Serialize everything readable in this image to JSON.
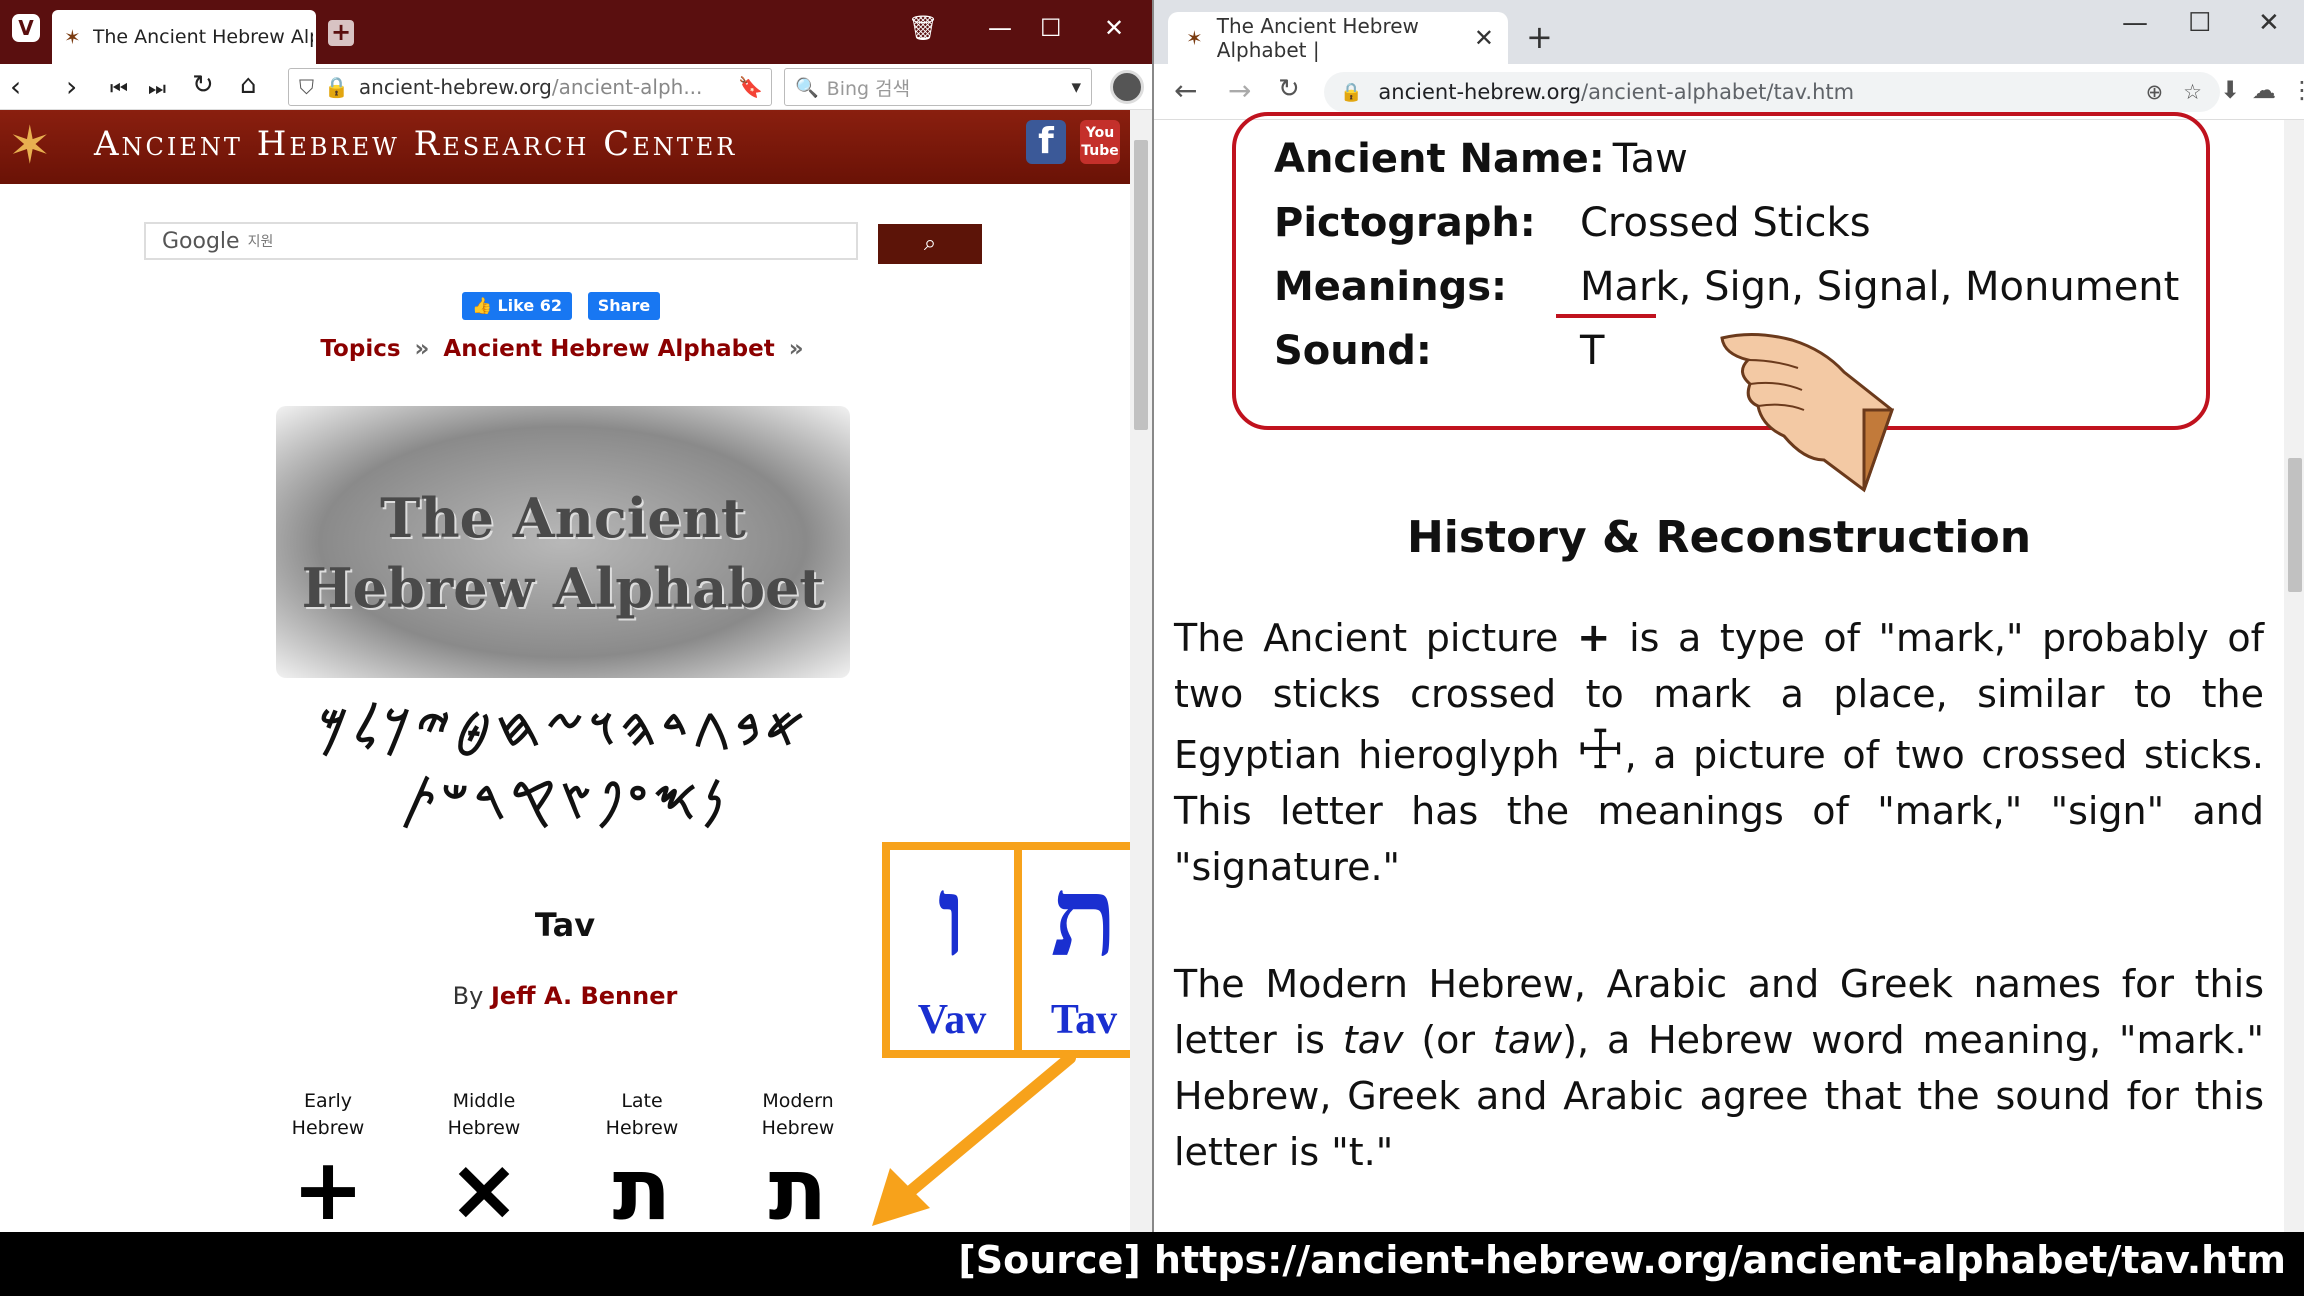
{
  "left": {
    "tab_title": "The Ancient Hebrew Alphab",
    "url_main": "ancient-hebrew.org",
    "url_path": "/ancient-alph...",
    "search_placeholder": "Bing 검색",
    "site_title": "Ancient Hebrew Research Center",
    "fb_icon": "f",
    "yt_icon": "You Tube",
    "google_label": "Google",
    "google_hint": "지원",
    "like_label": "Like 62",
    "share_label": "Share",
    "crumb_topics": "Topics",
    "crumb_alphabet": "Ancient Hebrew Alphabet",
    "crumb_sep": "»",
    "hero_line1": "The Ancient",
    "hero_line2": "Hebrew Alphabet",
    "glyphs_row1": "𐤀𐤁𐤂𐤃𐤄𐤅𐤆𐤇𐤈𐤉𐤊𐤋𐤌",
    "glyphs_row2": "𐤍𐤎𐤏𐤐𐤑𐤒𐤓𐤔𐤕",
    "letter_title": "Tav",
    "by_prefix": "By",
    "author": "Jeff A. Benner",
    "evolution": [
      {
        "line1": "Early",
        "line2": "Hebrew",
        "glyph": "+"
      },
      {
        "line1": "Middle",
        "line2": "Hebrew",
        "glyph": "×"
      },
      {
        "line1": "Late",
        "line2": "Hebrew",
        "glyph": "ת"
      },
      {
        "line1": "Modern",
        "line2": "Hebrew",
        "glyph": "ת"
      }
    ],
    "compare": [
      {
        "letter": "ו",
        "label": "Vav"
      },
      {
        "letter": "ת",
        "label": "Tav"
      }
    ]
  },
  "right": {
    "tab_title": "The Ancient Hebrew Alphabet |",
    "url_main": "ancient-hebrew.org",
    "url_path": "/ancient-alphabet/tav.htm",
    "info": [
      {
        "key": "Ancient Name:",
        "value": "Taw"
      },
      {
        "key": "Pictograph:",
        "value": "Crossed Sticks"
      },
      {
        "key": "Meanings:",
        "value": "Mark, Sign, Signal, Monument"
      },
      {
        "key": "Sound:",
        "value": "T"
      }
    ],
    "history_heading": "History & Reconstruction",
    "p1_a": "The Ancient picture",
    "p1_pic": "+",
    "p1_b": "is a type of \"mark,\" probably of two sticks crossed to mark a place, similar to the Egyptian hieroglyph",
    "p1_hiero": "☩",
    "p1_c": ", a picture of two crossed sticks. This letter has the meanings of \"mark,\" \"sign\" and \"signature.\"",
    "p2_a": "The Modern Hebrew, Arabic and Greek names for this letter is",
    "p2_tav": "tav",
    "p2_or": "(or",
    "p2_taw": "taw",
    "p2_b": "), a Hebrew word meaning, \"mark.\" Hebrew, Greek and Arabic agree that the sound for this letter is \"t.\""
  },
  "source": "[Source]  https://ancient-hebrew.org/ancient-alphabet/tav.htm",
  "colors": {
    "accent_orange": "#f7a21b",
    "hebrew_blue": "#1a2fd0",
    "frame_red": "#c0121e",
    "site_maroon": "#6a1206"
  }
}
